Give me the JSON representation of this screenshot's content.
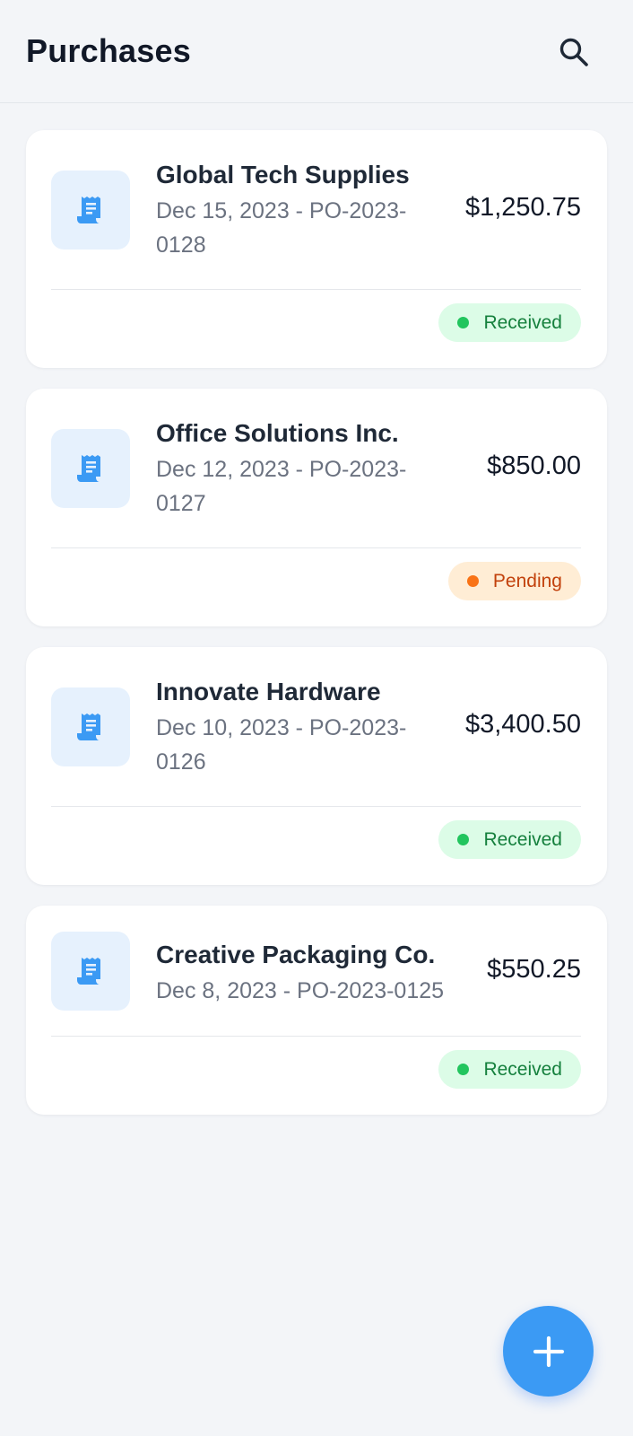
{
  "header": {
    "title": "Purchases",
    "search_icon": "search-icon"
  },
  "colors": {
    "accent": "#3b9af4",
    "icon_bg": "#e6f1fd",
    "received_bg": "#dcfce7",
    "received_text": "#15803d",
    "pending_bg": "#ffedd5",
    "pending_text": "#c2410c"
  },
  "purchases": [
    {
      "vendor": "Global Tech Supplies",
      "subtitle": "Dec 15, 2023 - PO-2023-0128",
      "amount": "$1,250.75",
      "status": "Received",
      "icon": "receipt-icon"
    },
    {
      "vendor": "Office Solutions Inc.",
      "subtitle": "Dec 12, 2023 - PO-2023-0127",
      "amount": "$850.00",
      "status": "Pending",
      "icon": "receipt-icon"
    },
    {
      "vendor": "Innovate Hardware",
      "subtitle": "Dec 10, 2023 - PO-2023-0126",
      "amount": "$3,400.50",
      "status": "Received",
      "icon": "receipt-icon"
    },
    {
      "vendor": "Creative Packaging Co.",
      "subtitle": "Dec 8, 2023 - PO-2023-0125",
      "amount": "$550.25",
      "status": "Received",
      "icon": "receipt-icon"
    }
  ],
  "fab": {
    "icon": "plus-icon"
  }
}
